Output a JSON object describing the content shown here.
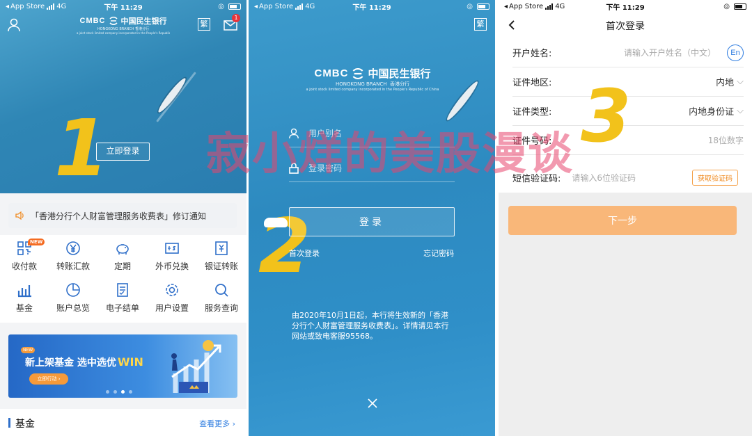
{
  "status_bar": {
    "back_app": "App Store",
    "network": "4G",
    "time": "下午 11:29"
  },
  "screen1": {
    "hero": {
      "logo_en": "CMBC",
      "logo_cn": "中国民生银行",
      "logo_sub_en": "HONGKONG BRANCH",
      "logo_sub_cn": "香港分行",
      "logo_tagline": "a joint stock limited company incorporated in the People's Republic of China",
      "trad_label": "繁",
      "mail_badge": "1",
      "login_button": "立即登录",
      "step_number": "1"
    },
    "notice": "「香港分行个人财富管理服务收费表」修订通知",
    "grid": [
      {
        "label": "收付款",
        "icon": "qr-pay-icon",
        "badge": "NEW"
      },
      {
        "label": "转账汇款",
        "icon": "yuan-transfer-icon"
      },
      {
        "label": "定期",
        "icon": "piggy-bank-icon"
      },
      {
        "label": "外币兑换",
        "icon": "currency-exchange-icon"
      },
      {
        "label": "银证转账",
        "icon": "securities-transfer-icon"
      },
      {
        "label": "基金",
        "icon": "bar-chart-icon"
      },
      {
        "label": "账户总览",
        "icon": "pie-chart-icon"
      },
      {
        "label": "电子结单",
        "icon": "statement-icon"
      },
      {
        "label": "用户设置",
        "icon": "gear-icon"
      },
      {
        "label": "服务查询",
        "icon": "search-icon"
      }
    ],
    "banner": {
      "badge": "NEW",
      "title": "新上架基金 选中选优",
      "title_win": "WIN",
      "button": "立即行动",
      "dots": 4,
      "active_dot": 2
    },
    "section": {
      "title": "基金",
      "more": "查看更多"
    }
  },
  "screen2": {
    "trad_label": "繁",
    "logo_en": "CMBC",
    "logo_cn": "中国民生银行",
    "logo_sub_en": "HONGKONG BRANCH",
    "logo_sub_cn": "香港分行",
    "logo_tagline": "a joint stock limited company incorporated in the People's Republic of China",
    "username_placeholder": "用户别名",
    "password_placeholder": "登录密码",
    "login_button": "登录",
    "first_login": "首次登录",
    "forgot_password": "忘记密码",
    "notice": "由2020年10月1日起，本行将生效新的「香港分行个人财富管理服务收费表」。详情请见本行网站或致电客服95568。",
    "step_number": "2"
  },
  "screen3": {
    "title": "首次登录",
    "rows": [
      {
        "label": "开户姓名:",
        "placeholder": "请输入开户姓名（中文）",
        "extra": "En"
      },
      {
        "label": "证件地区:",
        "value": "内地"
      },
      {
        "label": "证件类型:",
        "value": "内地身份证"
      },
      {
        "label": "证件号码:",
        "placeholder": "18位数字"
      },
      {
        "label": "短信验证码:",
        "placeholder": "请输入6位验证码",
        "button": "获取验证码"
      }
    ],
    "next_button": "下一步",
    "step_number": "3"
  },
  "watermark": "寂小烊的美股漫谈",
  "colors": {
    "accent_orange": "#f08a1f",
    "step_yellow": "#f2c21b",
    "watermark": "#e8466e",
    "link_blue": "#2f7de0"
  }
}
